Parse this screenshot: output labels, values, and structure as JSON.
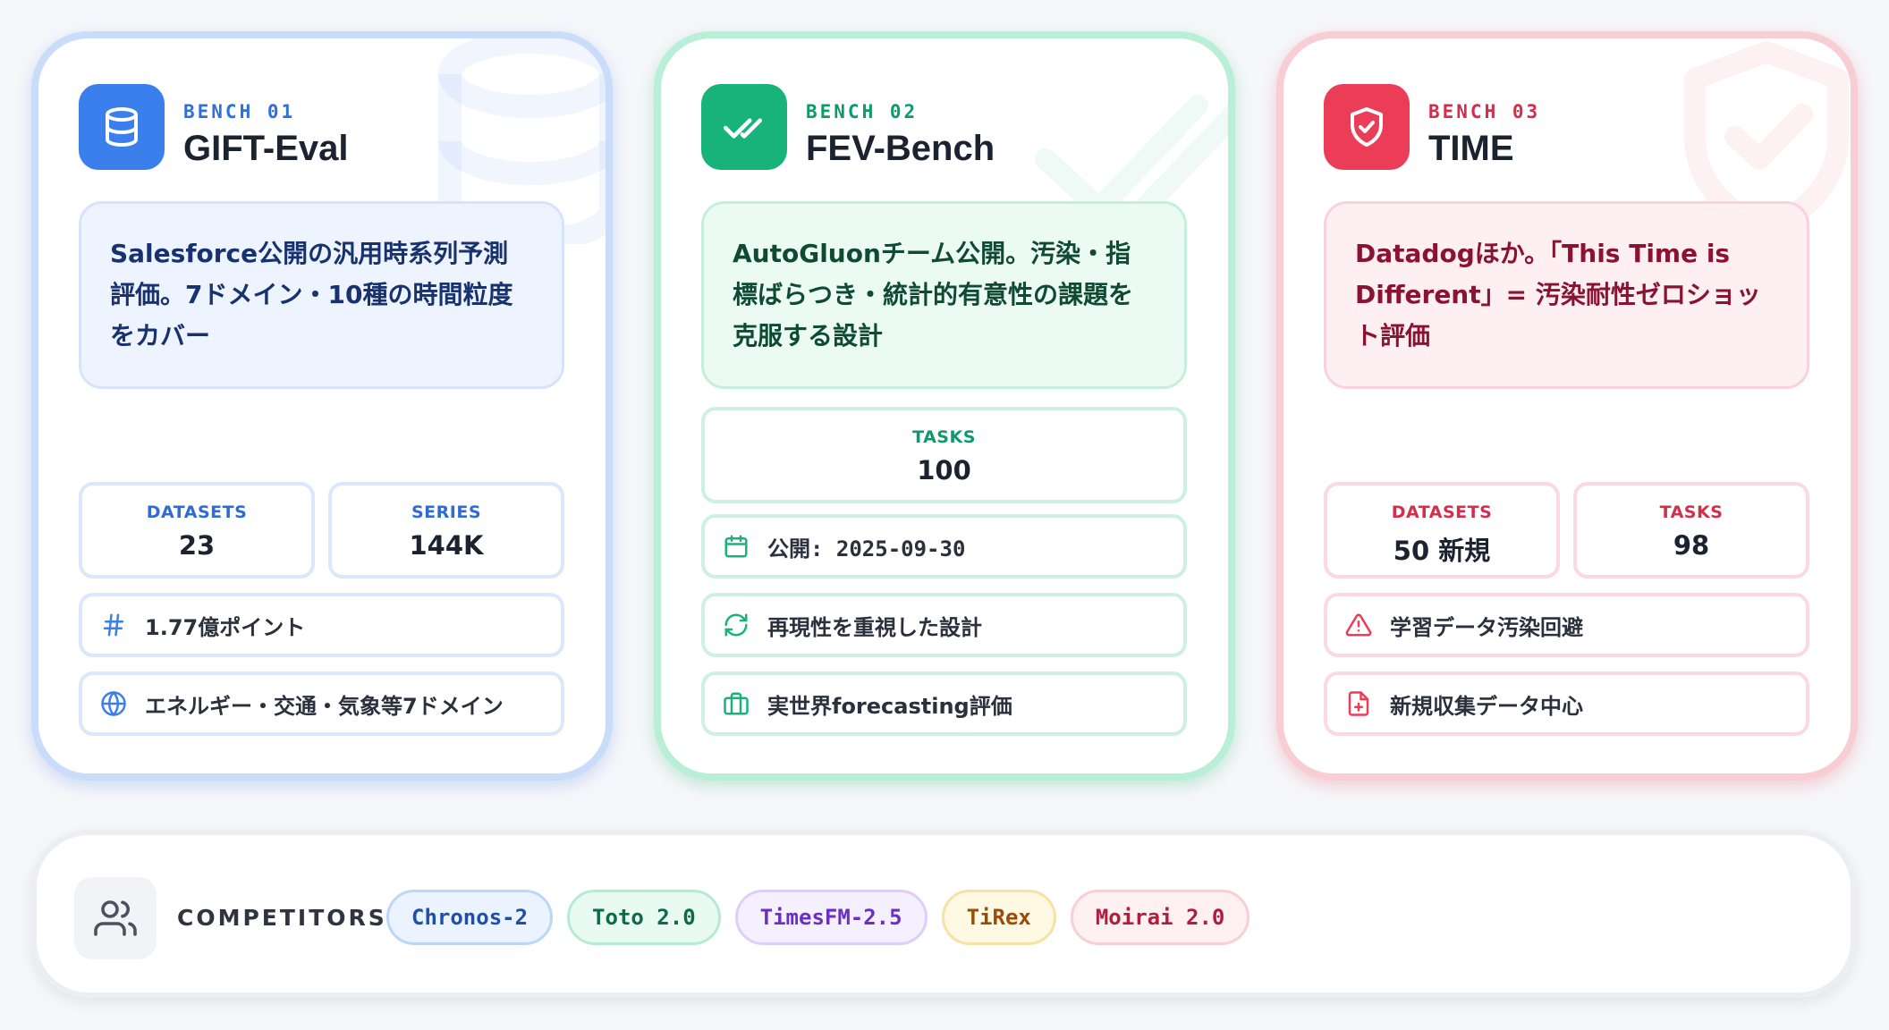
{
  "benches": [
    {
      "tag": "BENCH 01",
      "title": "GIFT-Eval",
      "icon": "database-icon",
      "color": "#3b7fec",
      "description": "Salesforce公開の汎用時系列予測評価。7ドメイン・10種の時間粒度をカバー",
      "stats": [
        {
          "label": "DATASETS",
          "value": "23"
        },
        {
          "label": "SERIES",
          "value": "144K"
        }
      ],
      "info": [
        {
          "icon": "hash-icon",
          "text": "1.77億ポイント"
        },
        {
          "icon": "globe-icon",
          "text": "エネルギー・交通・気象等7ドメイン"
        }
      ]
    },
    {
      "tag": "BENCH 02",
      "title": "FEV-Bench",
      "icon": "double-check-icon",
      "color": "#18b27b",
      "description": "AutoGluonチーム公開。汚染・指標ばらつき・統計的有意性の課題を克服する設計",
      "stats": [
        {
          "label": "TASKS",
          "value": "100"
        }
      ],
      "info": [
        {
          "icon": "calendar-icon",
          "text": "公開: 2025-09-30"
        },
        {
          "icon": "refresh-icon",
          "text": "再現性を重視した設計"
        },
        {
          "icon": "briefcase-icon",
          "text": "実世界forecasting評価"
        }
      ]
    },
    {
      "tag": "BENCH 03",
      "title": "TIME",
      "icon": "shield-check-icon",
      "color": "#ec3d58",
      "description": "Datadogほか。「This Time is Different」= 汚染耐性ゼロショット評価",
      "stats": [
        {
          "label": "DATASETS",
          "value": "50 新規"
        },
        {
          "label": "TASKS",
          "value": "98"
        }
      ],
      "info": [
        {
          "icon": "warning-icon",
          "text": "学習データ汚染回避"
        },
        {
          "icon": "file-plus-icon",
          "text": "新規収集データ中心"
        }
      ]
    }
  ],
  "competitors": {
    "label": "COMPETITORS",
    "icon": "users-icon",
    "items": [
      {
        "name": "Chronos-2",
        "bg": "#eaf3ff",
        "border": "#bcd6fa",
        "text": "#1f4fa8"
      },
      {
        "name": "Toto 2.0",
        "bg": "#e8faf1",
        "border": "#b5ebd2",
        "text": "#0d6b4a"
      },
      {
        "name": "TimesFM-2.5",
        "bg": "#f5f0ff",
        "border": "#dcd0fa",
        "text": "#6b2fc2"
      },
      {
        "name": "TiRex",
        "bg": "#fff8e2",
        "border": "#f6e2a4",
        "text": "#9a4d08"
      },
      {
        "name": "Moirai 2.0",
        "bg": "#fff0f2",
        "border": "#f9cfd6",
        "text": "#b01e3e"
      }
    ]
  }
}
